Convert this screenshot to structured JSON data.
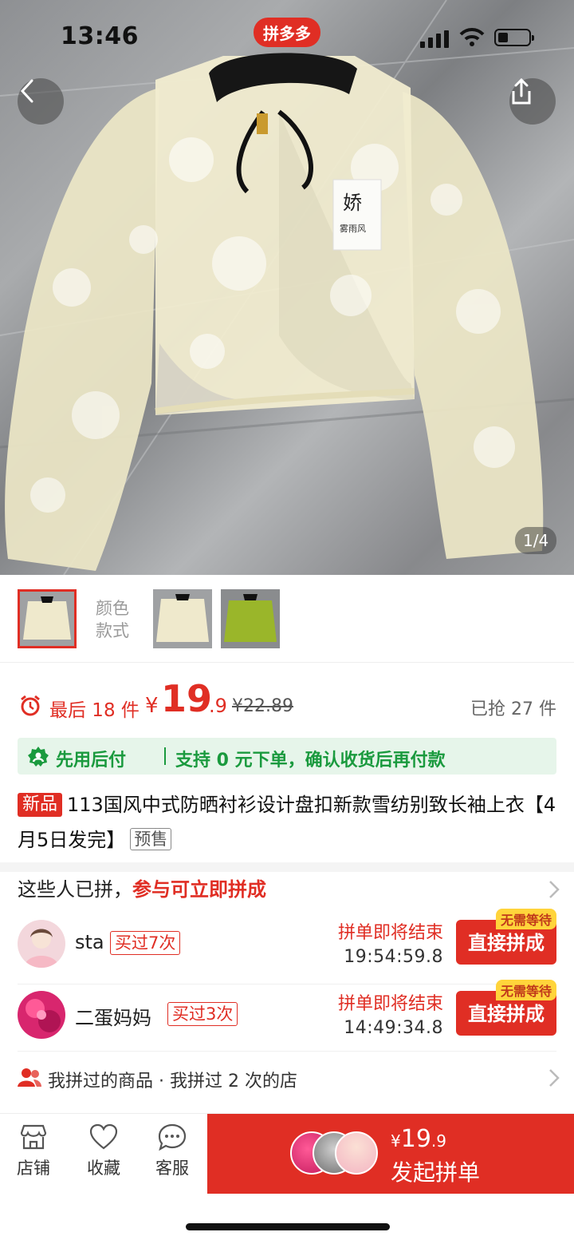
{
  "status_bar": {
    "time": "13:46",
    "brand_badge": "拼多多"
  },
  "gallery": {
    "counter": "1/4"
  },
  "variants": {
    "label": "颜色款式"
  },
  "price": {
    "last_count": "最后 18 件",
    "currency": "¥",
    "integer": "19",
    "decimal": ".9",
    "original": "¥22.89",
    "sold": "已抢 27 件"
  },
  "pay_later": {
    "title": "先用后付",
    "description": "支持 0 元下单，确认收货后再付款"
  },
  "product": {
    "new_tag": "新品",
    "title": "113国风中式防晒衬衫设计盘扣新款雪纺别致长袖上衣【4月5日发完】",
    "presale_tag": "预售"
  },
  "group_buy": {
    "header": "这些人已拼，",
    "header_highlight": "参与可立即拼成",
    "rows": [
      {
        "name": "sta",
        "bought": "买过7次",
        "ending": "拼单即将结束",
        "countdown": "19:54:59.8",
        "badge": "无需等待",
        "button": "直接拼成"
      },
      {
        "name": "二蛋妈妈",
        "bought": "买过3次",
        "ending": "拼单即将结束",
        "countdown": "14:49:34.8",
        "badge": "无需等待",
        "button": "直接拼成"
      }
    ]
  },
  "history": {
    "text": "我拼过的商品 · 我拼过 2 次的店"
  },
  "bottom_bar": {
    "store": "店铺",
    "favorite": "收藏",
    "service": "客服",
    "buy_currency": "¥",
    "buy_integer": "19",
    "buy_decimal": ".9",
    "buy_label": "发起拼单"
  },
  "colors": {
    "accent": "#e02e24",
    "green": "#1a9a3e",
    "badge_yellow": "#ffd43b"
  }
}
